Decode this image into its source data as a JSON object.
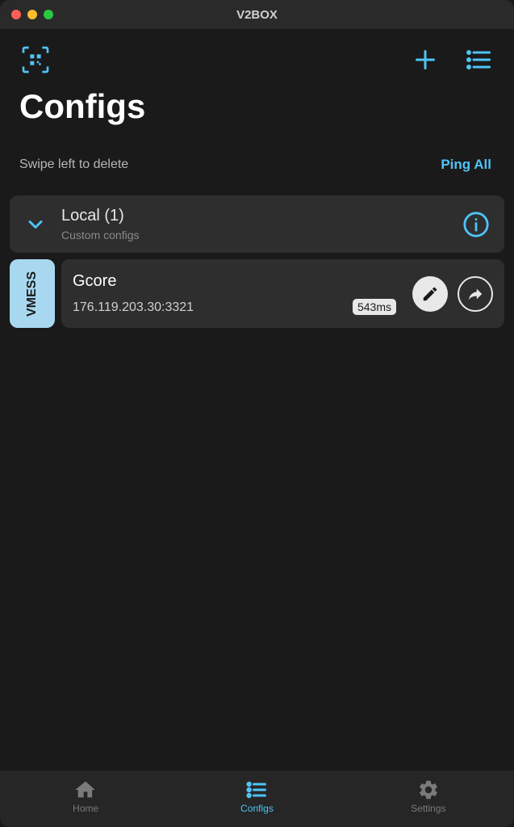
{
  "window": {
    "title": "V2BOX"
  },
  "page": {
    "title": "Configs",
    "hint": "Swipe left to delete",
    "ping_all_label": "Ping All"
  },
  "group": {
    "name": "Local (1)",
    "subtitle": "Custom configs"
  },
  "config": {
    "protocol": "VMESS",
    "name": "Gcore",
    "address": "176.119.203.30:3321",
    "ping": "543ms"
  },
  "nav": {
    "home": "Home",
    "configs": "Configs",
    "settings": "Settings"
  },
  "colors": {
    "accent": "#4fc3f7",
    "bg": "#1a1a1a",
    "card": "#2e2e2e"
  }
}
